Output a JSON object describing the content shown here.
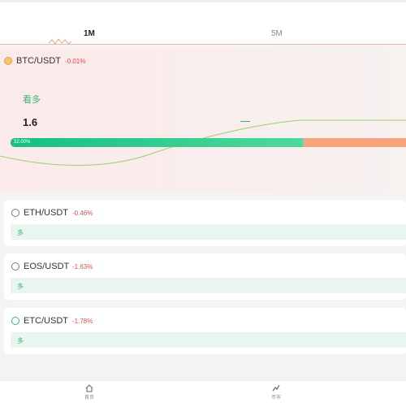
{
  "tabs": [
    {
      "label": "1M",
      "active": true
    },
    {
      "label": "5M",
      "active": false
    }
  ],
  "btc": {
    "pair": "BTC/USDT",
    "change": "-0.01%",
    "sub_label": "看多",
    "price": "1.6",
    "bar_percent_label": "32.00%",
    "icon": "bitcoin-icon"
  },
  "cards": [
    {
      "pair": "ETH/USDT",
      "change": "-0.46%",
      "bar_label": "多",
      "icon": "ethereum-icon"
    },
    {
      "pair": "EOS/USDT",
      "change": "-1.63%",
      "bar_label": "多",
      "icon": "eos-icon"
    },
    {
      "pair": "ETC/USDT",
      "change": "-1.78%",
      "bar_label": "多",
      "icon": "ethereum-classic-icon"
    }
  ],
  "nav": [
    {
      "label": "首页",
      "icon": "home-icon"
    },
    {
      "label": "币市",
      "icon": "chart-icon"
    }
  ],
  "colors": {
    "up_green": "#3db46d",
    "down_red": "#e34c4c",
    "bar_orange": "#f8a47d"
  }
}
